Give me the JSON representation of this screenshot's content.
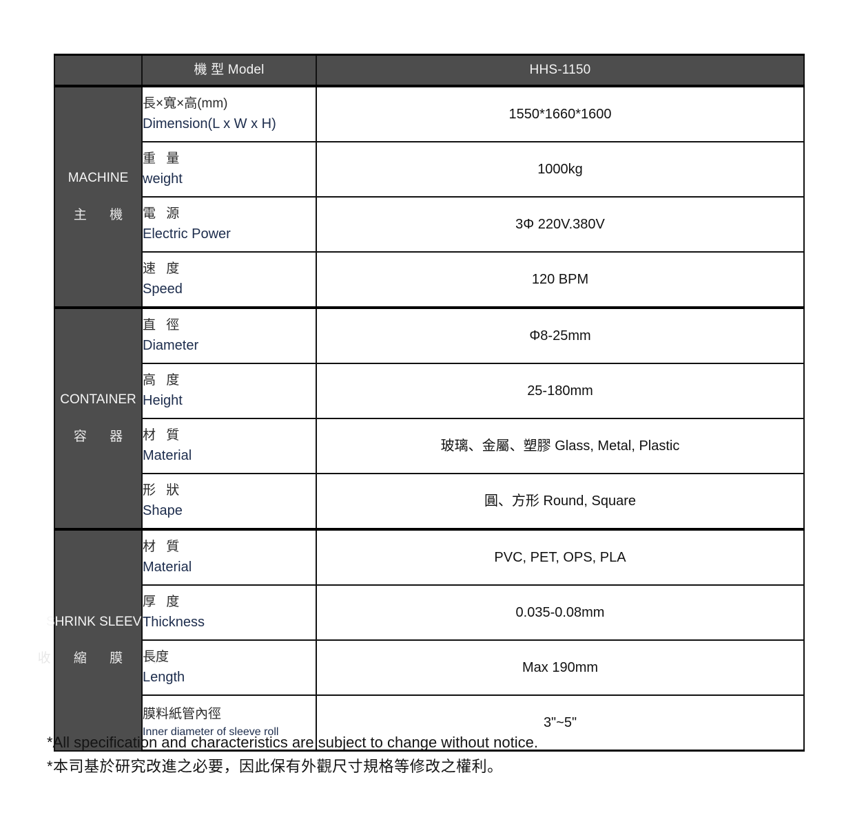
{
  "table": {
    "header": {
      "corner_label": "",
      "model_label": "機 型 Model",
      "model_value": "HHS-1150"
    },
    "groups": [
      {
        "id": "machine",
        "label_en": "MACHINE",
        "label_zh": "主 機",
        "rows": [
          {
            "name_zh": "長×寬×高(mm)",
            "name_en": "Dimension(L x W x H)",
            "value": "1550*1660*1600"
          },
          {
            "name_zh": "重 量",
            "name_en": "weight",
            "value": "1000kg"
          },
          {
            "name_zh": "電 源",
            "name_en": "Electric Power",
            "value": "3Φ  220V.380V"
          },
          {
            "name_zh": "速 度",
            "name_en": "Speed",
            "value": "120 BPM"
          }
        ]
      },
      {
        "id": "container",
        "label_en": "CONTAINER",
        "label_zh": "容 器",
        "rows": [
          {
            "name_zh": "直 徑",
            "name_en": "Diameter",
            "value": "Φ8-25mm"
          },
          {
            "name_zh": "高 度",
            "name_en": "Height",
            "value": "25-180mm"
          },
          {
            "name_zh": "材 質",
            "name_en": "Material",
            "value": "玻璃、金屬、塑膠  Glass, Metal, Plastic"
          },
          {
            "name_zh": "形 狀",
            "name_en": "Shape",
            "value": "圓、方形  Round, Square"
          }
        ]
      },
      {
        "id": "shrink-sleeve",
        "label_en": "SHRINK SLEEVE",
        "label_zh": "收 縮 膜 材",
        "rows": [
          {
            "name_zh": "材 質",
            "name_en": "Material",
            "value": "PVC, PET, OPS, PLA"
          },
          {
            "name_zh": "厚 度",
            "name_en": "Thickness",
            "value": "0.035-0.08mm"
          },
          {
            "name_zh": "長度",
            "name_en": "Length",
            "value": "Max 190mm"
          },
          {
            "name_zh": "膜料紙管內徑",
            "name_en": "Inner diameter of sleeve roll",
            "value": "3\"~5\""
          }
        ]
      }
    ]
  },
  "footnotes": {
    "line_en": "*All specification and characteristics are subject to change without notice.",
    "line_zh": "*本司基於研究改進之必要，因此保有外觀尺寸規格等修改之權利。"
  },
  "colors": {
    "header_gray": "#4d4d4d",
    "border_black": "#111111",
    "label_navy": "#1c2c4c",
    "text_dark": "#141414"
  }
}
